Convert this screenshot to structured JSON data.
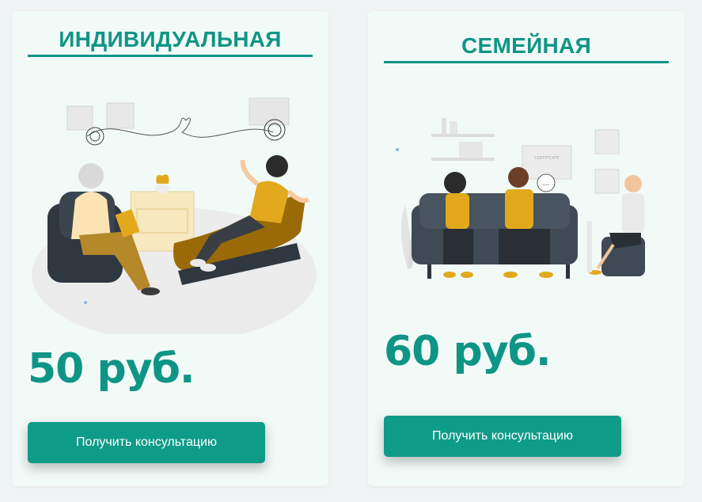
{
  "cards": [
    {
      "title": "ИНДИВИДУАЛЬНАЯ",
      "illustration": "individual-therapy-illustration",
      "price": "50 руб.",
      "button_label": "Получить консультацию"
    },
    {
      "title": "СЕМЕЙНАЯ",
      "illustration": "family-therapy-illustration",
      "certificate_text": "CERTIFICATE",
      "speech_text": "...",
      "price": "60 руб.",
      "button_label": "Получить консультацию"
    }
  ],
  "colors": {
    "accent": "#0f9586",
    "button": "#0e9c89",
    "card_bg": "#f2faf8",
    "mustard": "#e2a91d",
    "sofa": "#3f4a55"
  }
}
